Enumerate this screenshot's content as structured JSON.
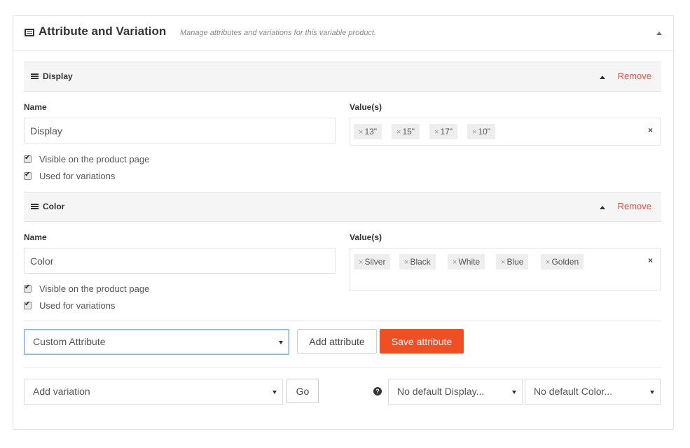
{
  "panel": {
    "title": "Attribute and Variation",
    "subtitle": "Manage attributes and variations for this variable product."
  },
  "attributes": [
    {
      "title": "Display",
      "remove_label": "Remove",
      "name_label": "Name",
      "name_value": "Display",
      "values_label": "Value(s)",
      "values": [
        "13\"",
        "15\"",
        "17\"",
        "10\""
      ],
      "visible_label": "Visible on the product page",
      "variations_label": "Used for variations"
    },
    {
      "title": "Color",
      "remove_label": "Remove",
      "name_label": "Name",
      "name_value": "Color",
      "values_label": "Value(s)",
      "values": [
        "Silver",
        "Black",
        "White",
        "Blue",
        "Golden"
      ],
      "visible_label": "Visible on the product page",
      "variations_label": "Used for variations"
    }
  ],
  "attribute_controls": {
    "select_value": "Custom Attribute",
    "add_label": "Add attribute",
    "save_label": "Save attribute"
  },
  "variation_controls": {
    "select_value": "Add variation",
    "go_label": "Go",
    "default_display": "No default Display...",
    "default_color": "No default Color..."
  },
  "tag_remove_glyph": "×",
  "clear_glyph": "×",
  "help_glyph": "?",
  "colors": {
    "accent": "#f04e23",
    "remove_link": "#e84c3d",
    "focus_border": "#8ab4e8"
  }
}
